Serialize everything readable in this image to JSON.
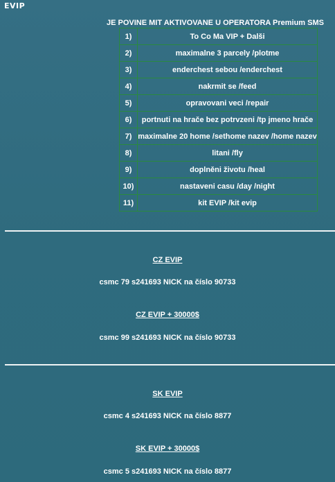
{
  "logo": "EVIP",
  "heading": "JE POVINE MIT AKTIVOVANE U OPERATORA Premium SMS",
  "commands": [
    {
      "num": "1)",
      "text": "To Co Ma VIP + Dalši"
    },
    {
      "num": "2)",
      "text": "maximalne 3 parcely /plotme"
    },
    {
      "num": "3)",
      "text": "enderchest sebou /enderchest"
    },
    {
      "num": "4)",
      "text": "nakrmit se /feed"
    },
    {
      "num": "5)",
      "text": "opravovani veci /repair"
    },
    {
      "num": "6)",
      "text": "portnuti na hrače bez potrvzeni /tp jmeno hrače"
    },
    {
      "num": "7)",
      "text": "maximalne 20 home /sethome nazev /home nazev"
    },
    {
      "num": "8)",
      "text": "litani /fly"
    },
    {
      "num": "9)",
      "text": "doplněni životu /heal"
    },
    {
      "num": "10)",
      "text": "nastaveni casu /day /night"
    },
    {
      "num": "11)",
      "text": "kit EVIP /kit evip"
    }
  ],
  "cz": {
    "evip_title": "CZ EVIP",
    "evip_sms": "csmc 79 s241693 NICK na číslo 90733",
    "evip_plus_title": "CZ EVIP + 30000$",
    "evip_plus_sms": "csmc 99 s241693 NICK na číslo 90733"
  },
  "sk": {
    "evip_title": "SK EVIP",
    "evip_sms": "csmc 4 s241693 NICK na číslo 8877",
    "evip_plus_title": "SK EVIP + 30000$",
    "evip_plus_sms": "csmc 5 s241693 NICK na číslo 8877"
  }
}
